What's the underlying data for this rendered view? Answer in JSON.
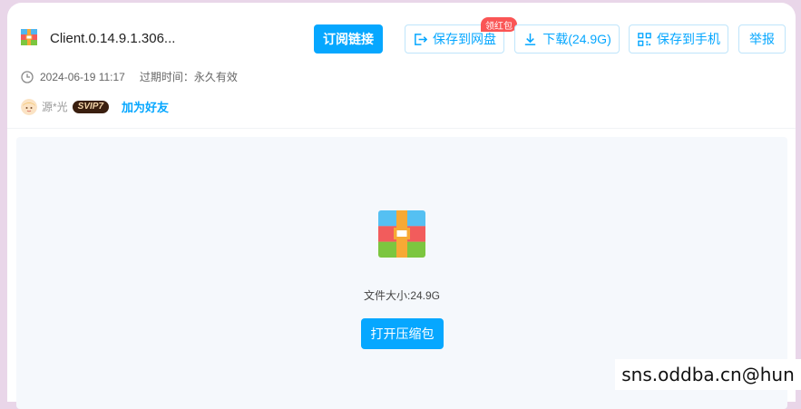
{
  "file": {
    "name": "Client.0.14.9.1.306...",
    "icon": "archive-icon"
  },
  "actions": {
    "subscribe": "订阅链接",
    "save_to_drive": "保存到网盘",
    "save_badge": "领红包",
    "download": "下载(24.9G)",
    "save_to_phone": "保存到手机",
    "report": "举报"
  },
  "meta": {
    "date": "2024-06-19 11:17",
    "expiry": "过期时间：永久有效"
  },
  "user": {
    "name": "源*光",
    "level": "SVIP7",
    "add_friend": "加为好友"
  },
  "preview": {
    "size": "文件大小:24.9G",
    "open": "打开压缩包"
  },
  "watermark": "sns.oddba.cn@hun",
  "colors": {
    "accent": "#06a7ff",
    "badge": "#fa5555",
    "preview_bg": "#f5f8fc",
    "page_bg": "#e9d6e9"
  }
}
